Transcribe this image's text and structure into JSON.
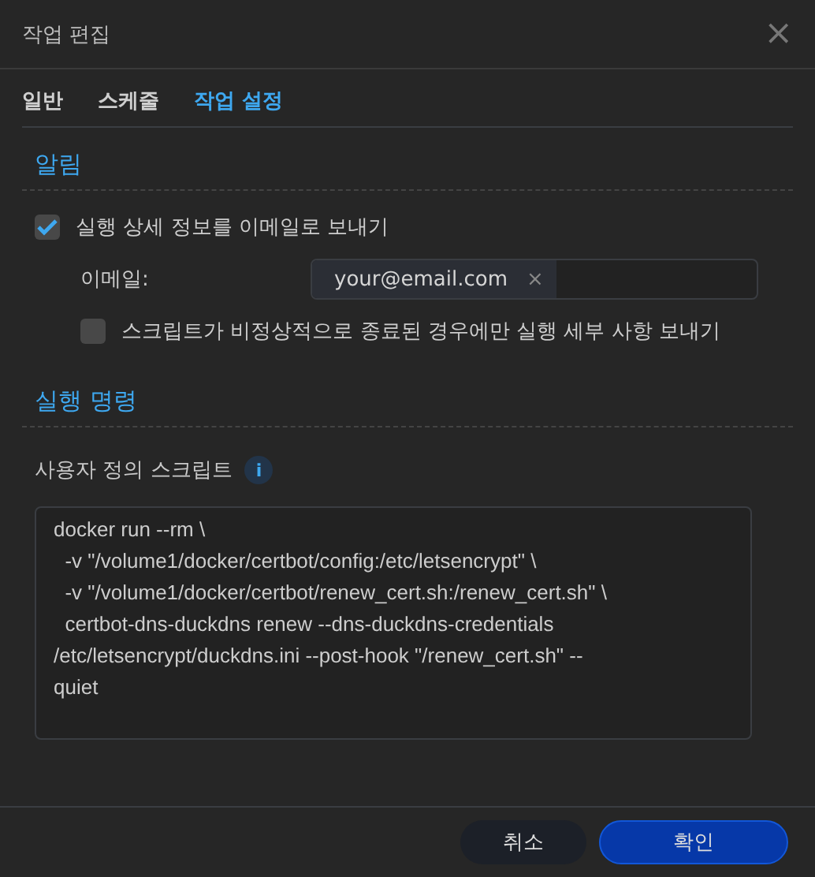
{
  "window": {
    "title": "작업 편집",
    "close": "×"
  },
  "tabs": [
    {
      "label": "일반",
      "selected": false
    },
    {
      "label": "스케줄",
      "selected": false
    },
    {
      "label": "작업 설정",
      "selected": true
    }
  ],
  "notification": {
    "heading": "알림",
    "send_details": {
      "label": "실행 상세 정보를 이메일로 보내기",
      "checked": true
    },
    "email": {
      "label": "이메일:",
      "tags": [
        {
          "text": "your@email.com",
          "remove": "×"
        }
      ]
    },
    "only_abnormal": {
      "label": "스크립트가 비정상적으로 종료된 경우에만 실행 세부 사항 보내기",
      "checked": false
    }
  },
  "command": {
    "heading": "실행 명령",
    "script_label": "사용자 정의 스크립트",
    "info": "i",
    "script_lines": [
      "docker run --rm \\",
      "  -v \"/volume1/docker/certbot/config:/etc/letsencrypt\" \\",
      "  -v \"/volume1/docker/certbot/renew_cert.sh:/renew_cert.sh\" \\",
      "  certbot-dns-duckdns renew --dns-duckdns-credentials",
      "/etc/letsencrypt/duckdns.ini --post-hook \"/renew_cert.sh\" --",
      "quiet"
    ]
  },
  "buttons": [
    {
      "label": "취소",
      "kind": "secondary"
    },
    {
      "label": "확인",
      "kind": "primary"
    }
  ]
}
